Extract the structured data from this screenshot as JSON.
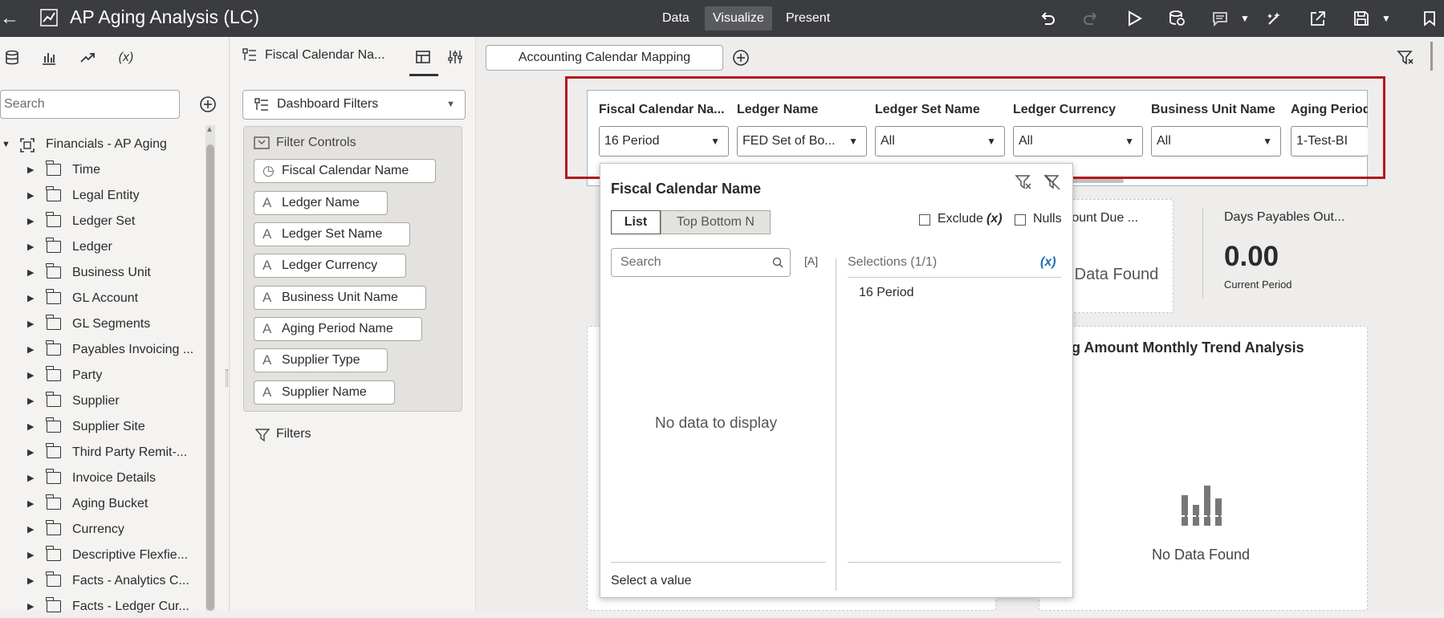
{
  "app": {
    "title": "AP Aging Analysis (LC)"
  },
  "modes": [
    "Data",
    "Visualize",
    "Present"
  ],
  "left_panel": {
    "search_placeholder": "Search",
    "root": "Financials - AP Aging",
    "items": [
      "Time",
      "Legal Entity",
      "Ledger Set",
      "Ledger",
      "Business Unit",
      "GL Account",
      "GL Segments",
      "Payables Invoicing ...",
      "Party",
      "Supplier",
      "Supplier Site",
      "Third Party Remit-...",
      "Invoice Details",
      "Aging Bucket",
      "Currency",
      "Descriptive Flexfie...",
      "Facts - Analytics C...",
      "Facts - Ledger Cur..."
    ]
  },
  "mid_panel": {
    "header": "Fiscal Calendar Na...",
    "dashboard_filters": "Dashboard Filters",
    "filter_controls": "Filter Controls",
    "chips": [
      "Fiscal Calendar Name",
      "Ledger Name",
      "Ledger Set Name",
      "Ledger Currency",
      "Business Unit Name",
      "Aging Period Name",
      "Supplier Type",
      "Supplier Name"
    ],
    "filters": "Filters"
  },
  "canvas": {
    "tab": "Accounting Calendar Mapping",
    "filters": [
      {
        "label": "Fiscal Calendar Na...",
        "value": "16 Period"
      },
      {
        "label": "Ledger Name",
        "value": "FED Set of Bo..."
      },
      {
        "label": "Ledger Set Name",
        "value": "All"
      },
      {
        "label": "Ledger Currency",
        "value": "All"
      },
      {
        "label": "Business Unit Name",
        "value": "All"
      },
      {
        "label": "Aging Period",
        "value": "1-Test-BI"
      }
    ],
    "card1": {
      "title_partial": "mount Due ...",
      "value": "o Data Found"
    },
    "card2": {
      "title": "Days Payables Out...",
      "value": "0.00",
      "sub": "Current Period"
    },
    "trend": {
      "title": "ing Amount Monthly Trend Analysis",
      "empty": "No Data Found"
    }
  },
  "popup": {
    "title": "Fiscal Calendar Name",
    "seg_list": "List",
    "seg_topbottom": "Top Bottom N",
    "exclude": "Exclude",
    "exclude_x": "(x)",
    "nulls": "Nulls",
    "search_placeholder": "Search",
    "case_icon": "[A]",
    "selections": "Selections (1/1)",
    "sel_x": "(x)",
    "selected": [
      "16 Period"
    ],
    "no_data": "No data to display",
    "footer": "Select a value"
  }
}
